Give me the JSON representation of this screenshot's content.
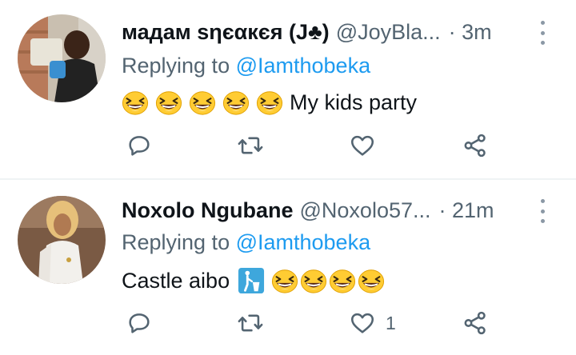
{
  "tweets": [
    {
      "name": "мадам ѕηєαкєя (J♣)",
      "handle": "@JoyBla...",
      "time": "· 3m",
      "replying_prefix": "Replying to ",
      "replying_handle": "@Iamthobeka",
      "emojis": [
        "grinning-squinting-face-emoji",
        "grinning-squinting-face-emoji",
        "grinning-squinting-face-emoji",
        "grinning-squinting-face-emoji",
        "grinning-squinting-face-emoji"
      ],
      "text": "My kids party",
      "like_count": ""
    },
    {
      "name": "Noxolo Ngubane",
      "handle": "@Noxolo57...",
      "time": "· 21m",
      "replying_prefix": "Replying to ",
      "replying_handle": "@Iamthobeka",
      "text": "Castle aibo",
      "emojis": [
        "litter-in-bin-sign-emoji",
        "grinning-squinting-face-emoji",
        "grinning-squinting-face-emoji",
        "grinning-squinting-face-emoji",
        "grinning-squinting-face-emoji"
      ],
      "like_count": "1"
    }
  ],
  "icons": {
    "reply": "reply-icon",
    "retweet": "retweet-icon",
    "like": "heart-icon",
    "share": "share-icon",
    "more": "more-options-icon"
  },
  "colors": {
    "link": "#1d9bf0",
    "secondary_text": "#536471",
    "icon": "#536471",
    "emoji_yellow": "#ffcc33",
    "litter_sign": "#3ea7dc"
  }
}
